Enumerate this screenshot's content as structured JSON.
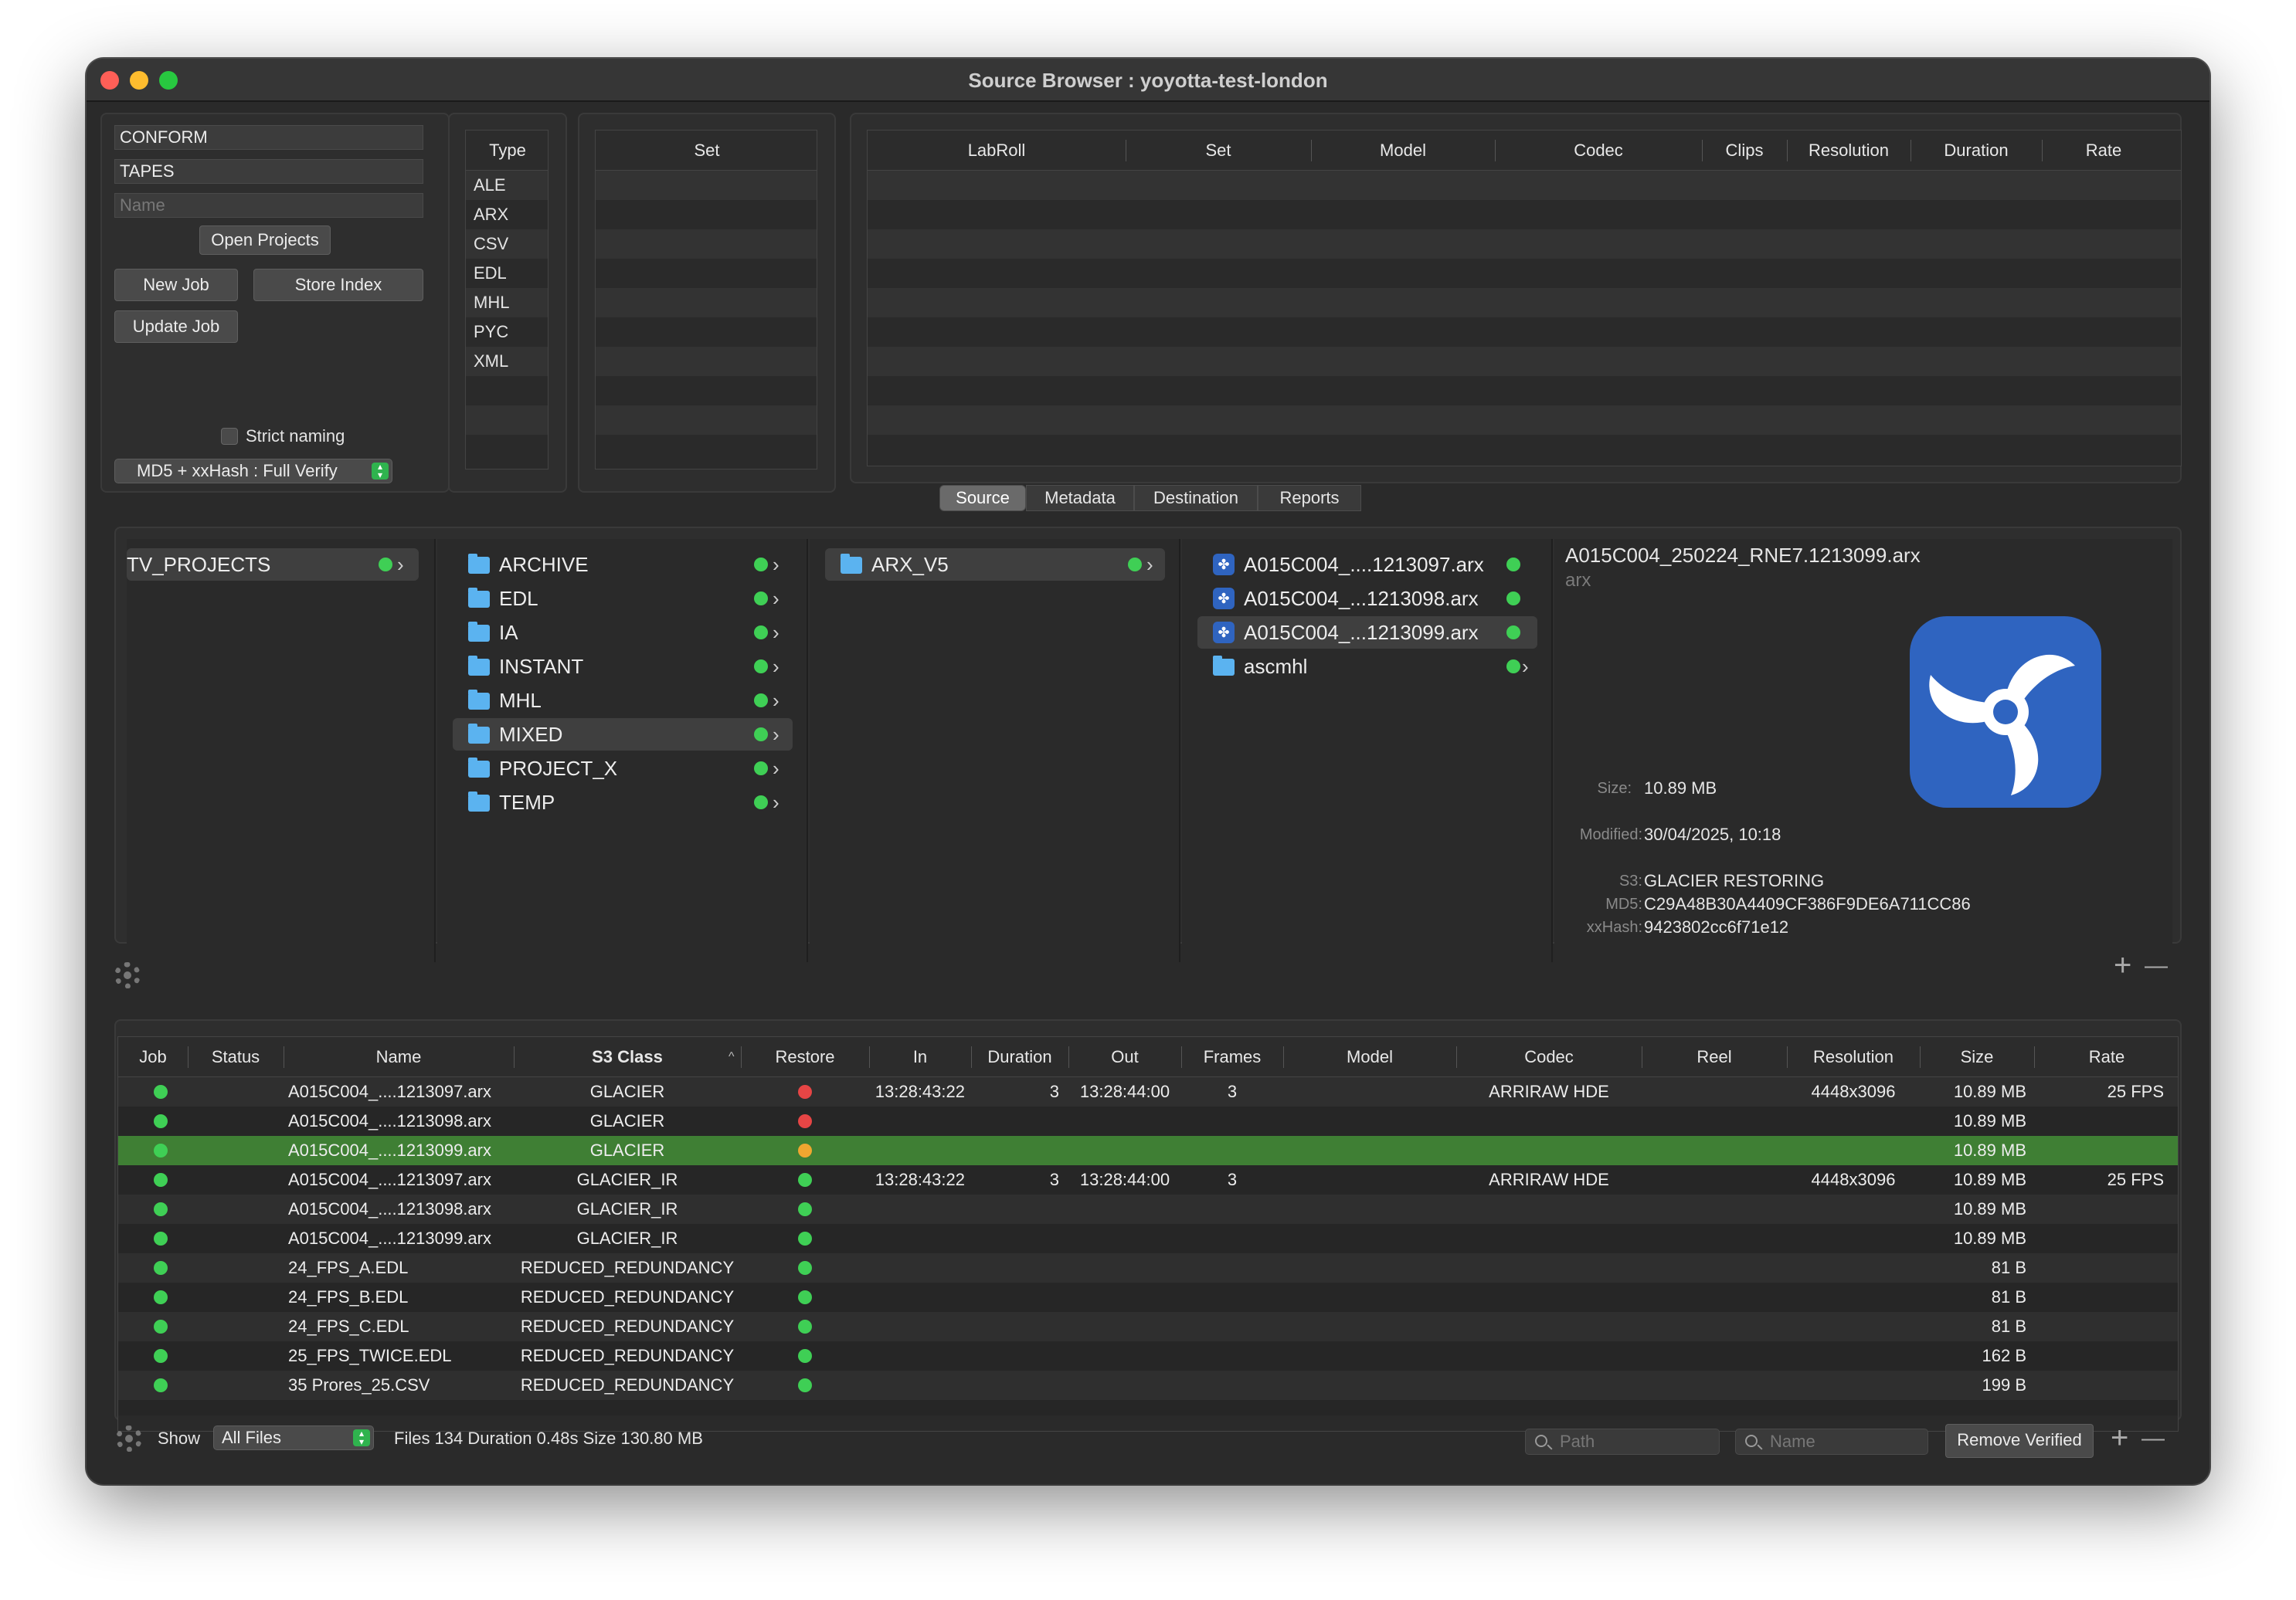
{
  "window": {
    "title": "Source Browser : yoyotta-test-london"
  },
  "left_panel": {
    "conform": "CONFORM",
    "tapes": "TAPES",
    "name_placeholder": "Name",
    "open_projects": "Open Projects",
    "new_job": "New Job",
    "store_index": "Store Index",
    "update_job": "Update Job",
    "strict_naming": "Strict naming",
    "verify_mode": "MD5 + xxHash : Full Verify"
  },
  "type_table": {
    "header": "Type",
    "items": [
      "ALE",
      "ARX",
      "CSV",
      "EDL",
      "MHL",
      "PYC",
      "XML"
    ]
  },
  "set_table": {
    "header": "Set"
  },
  "labroll_table": {
    "headers": [
      "LabRoll",
      "Set",
      "Model",
      "Codec",
      "Clips",
      "Resolution",
      "Duration",
      "Rate"
    ]
  },
  "tabs": [
    "Source",
    "Metadata",
    "Destination",
    "Reports"
  ],
  "browser": {
    "col1": [
      "TV_PROJECTS"
    ],
    "col2": [
      "ARCHIVE",
      "EDL",
      "IA",
      "INSTANT",
      "MHL",
      "MIXED",
      "PROJECT_X",
      "TEMP"
    ],
    "col3": [
      "ARX_V5"
    ],
    "col4": [
      {
        "name": "A015C004_....1213097.arx",
        "kind": "arx"
      },
      {
        "name": "A015C004_...1213098.arx",
        "kind": "arx"
      },
      {
        "name": "A015C004_...1213099.arx",
        "kind": "arx"
      },
      {
        "name": "ascmhl",
        "kind": "folder"
      }
    ],
    "preview": {
      "filename": "A015C004_250224_RNE7.1213099.arx",
      "ext": "arx",
      "size_label": "Size:",
      "size": "10.89 MB",
      "modified_label": "Modified:",
      "modified": "30/04/2025, 10:18",
      "s3_label": "S3:",
      "s3": "GLACIER RESTORING",
      "md5_label": "MD5:",
      "md5": "C29A48B30A4409CF386F9DE6A711CC86",
      "xxhash_label": "xxHash:",
      "xxhash": "9423802cc6f71e12"
    }
  },
  "jobs_table": {
    "headers": [
      "Job",
      "Status",
      "Name",
      "S3 Class",
      "Restore",
      "In",
      "Duration",
      "Out",
      "Frames",
      "Model",
      "Codec",
      "Reel",
      "Resolution",
      "Size",
      "Rate"
    ],
    "rows": [
      {
        "restore": "#e64545",
        "name": "A015C004_....1213097.arx",
        "s3": "GLACIER",
        "in": "13:28:43:22",
        "dur": "3",
        "out": "13:28:44:00",
        "frames": "3",
        "codec": "ARRIRAW HDE",
        "res": "4448x3096",
        "size": "10.89 MB",
        "rate": "25 FPS"
      },
      {
        "restore": "#e64545",
        "name": "A015C004_....1213098.arx",
        "s3": "GLACIER",
        "in": "",
        "dur": "",
        "out": "",
        "frames": "",
        "codec": "",
        "res": "",
        "size": "10.89 MB",
        "rate": ""
      },
      {
        "restore": "#f0a630",
        "name": "A015C004_....1213099.arx",
        "s3": "GLACIER",
        "in": "",
        "dur": "",
        "out": "",
        "frames": "",
        "codec": "",
        "res": "",
        "size": "10.89 MB",
        "rate": ""
      },
      {
        "restore": "#3fcf55",
        "name": "A015C004_....1213097.arx",
        "s3": "GLACIER_IR",
        "in": "13:28:43:22",
        "dur": "3",
        "out": "13:28:44:00",
        "frames": "3",
        "codec": "ARRIRAW HDE",
        "res": "4448x3096",
        "size": "10.89 MB",
        "rate": "25 FPS"
      },
      {
        "restore": "#3fcf55",
        "name": "A015C004_....1213098.arx",
        "s3": "GLACIER_IR",
        "in": "",
        "dur": "",
        "out": "",
        "frames": "",
        "codec": "",
        "res": "",
        "size": "10.89 MB",
        "rate": ""
      },
      {
        "restore": "#3fcf55",
        "name": "A015C004_....1213099.arx",
        "s3": "GLACIER_IR",
        "in": "",
        "dur": "",
        "out": "",
        "frames": "",
        "codec": "",
        "res": "",
        "size": "10.89 MB",
        "rate": ""
      },
      {
        "restore": "#3fcf55",
        "name": "24_FPS_A.EDL",
        "s3": "REDUCED_REDUNDANCY",
        "in": "",
        "dur": "",
        "out": "",
        "frames": "",
        "codec": "",
        "res": "",
        "size": "81 B",
        "rate": ""
      },
      {
        "restore": "#3fcf55",
        "name": "24_FPS_B.EDL",
        "s3": "REDUCED_REDUNDANCY",
        "in": "",
        "dur": "",
        "out": "",
        "frames": "",
        "codec": "",
        "res": "",
        "size": "81 B",
        "rate": ""
      },
      {
        "restore": "#3fcf55",
        "name": "24_FPS_C.EDL",
        "s3": "REDUCED_REDUNDANCY",
        "in": "",
        "dur": "",
        "out": "",
        "frames": "",
        "codec": "",
        "res": "",
        "size": "81 B",
        "rate": ""
      },
      {
        "restore": "#3fcf55",
        "name": "25_FPS_TWICE.EDL",
        "s3": "REDUCED_REDUNDANCY",
        "in": "",
        "dur": "",
        "out": "",
        "frames": "",
        "codec": "",
        "res": "",
        "size": "162 B",
        "rate": ""
      },
      {
        "restore": "#3fcf55",
        "name": "35 Prores_25.CSV",
        "s3": "REDUCED_REDUNDANCY",
        "in": "",
        "dur": "",
        "out": "",
        "frames": "",
        "codec": "",
        "res": "",
        "size": "199 B",
        "rate": ""
      }
    ],
    "selected_row": 2
  },
  "footer": {
    "show_label": "Show",
    "show_value": "All Files",
    "stats": "Files 134 Duration 0.48s Size 130.80 MB",
    "path_placeholder": "Path",
    "name_placeholder": "Name",
    "remove_verified": "Remove Verified",
    "add": "+",
    "remove": "—"
  },
  "colors": {
    "status_green": "#3fcf55",
    "selection_green": "#3f7f34",
    "folder_blue": "#5bb3f0",
    "arx_blue": "#2f64c0"
  }
}
